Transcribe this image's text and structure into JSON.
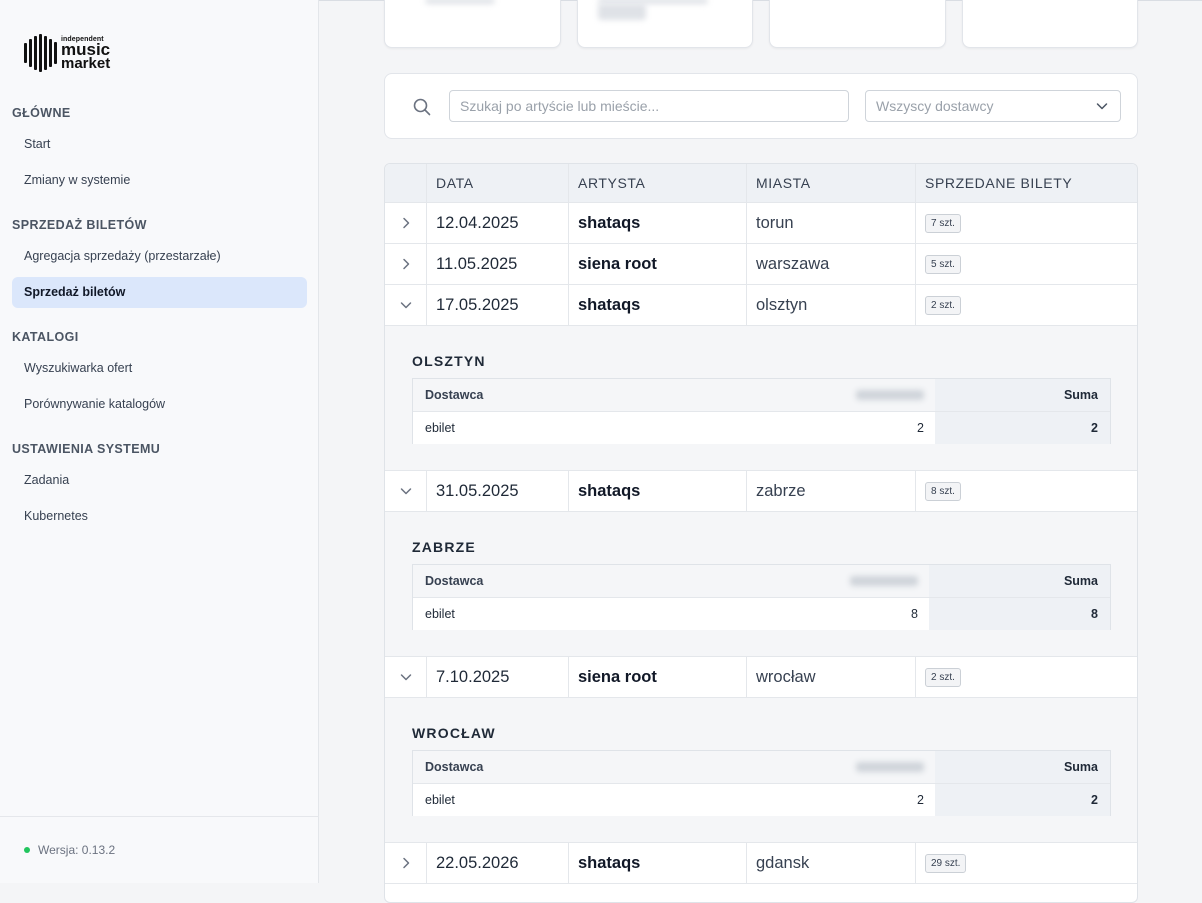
{
  "brand": {
    "line1": "independent",
    "line2": "music",
    "line3": "market"
  },
  "nav": {
    "sections": [
      {
        "label": "GŁÓWNE",
        "items": [
          {
            "label": "Start"
          },
          {
            "label": "Zmiany w systemie"
          }
        ]
      },
      {
        "label": "SPRZEDAŻ BILETÓW",
        "items": [
          {
            "label": "Agregacja sprzedaży (przestarzałe)"
          },
          {
            "label": "Sprzedaż biletów",
            "active": true
          }
        ]
      },
      {
        "label": "KATALOGI",
        "items": [
          {
            "label": "Wyszukiwarka ofert"
          },
          {
            "label": "Porównywanie katalogów"
          }
        ]
      },
      {
        "label": "USTAWIENIA SYSTEMU",
        "items": [
          {
            "label": "Zadania"
          },
          {
            "label": "Kubernetes"
          }
        ]
      }
    ]
  },
  "version": {
    "label": "Wersja: 0.13.2"
  },
  "filters": {
    "search_placeholder": "Szukaj po artyście lub mieście...",
    "supplier_value": "Wszyscy dostawcy"
  },
  "table": {
    "headers": {
      "date": "DATA",
      "artist": "ARTYSTA",
      "city": "MIASTA",
      "sold": "SPRZEDANE BILETY"
    },
    "rows": [
      {
        "date": "12.04.2025",
        "artist": "shataqs",
        "city": "torun",
        "sold": "7 szt.",
        "expanded": false
      },
      {
        "date": "11.05.2025",
        "artist": "siena root",
        "city": "warszawa",
        "sold": "5 szt.",
        "expanded": false
      },
      {
        "date": "17.05.2025",
        "artist": "shataqs",
        "city": "olsztyn",
        "sold": "2 szt.",
        "expanded": true,
        "detail": {
          "title": "OLSZTYN",
          "col_supplier": "Dostawca",
          "col_sum": "Suma",
          "supplier": "ebilet",
          "value": "2",
          "sum": "2"
        }
      },
      {
        "date": "31.05.2025",
        "artist": "shataqs",
        "city": "zabrze",
        "sold": "8 szt.",
        "expanded": true,
        "detail": {
          "title": "ZABRZE",
          "col_supplier": "Dostawca",
          "col_sum": "Suma",
          "supplier": "ebilet",
          "value": "8",
          "sum": "8"
        }
      },
      {
        "date": "7.10.2025",
        "artist": "siena root",
        "city": "wrocław",
        "sold": "2 szt.",
        "expanded": true,
        "detail": {
          "title": "WROCŁAW",
          "col_supplier": "Dostawca",
          "col_sum": "Suma",
          "supplier": "ebilet",
          "value": "2",
          "sum": "2"
        }
      },
      {
        "date": "22.05.2026",
        "artist": "shataqs",
        "city": "gdansk",
        "sold": "29 szt.",
        "expanded": false
      }
    ]
  },
  "colors": {
    "accent_active": "#dbe7fb",
    "status_dot": "#22c55e"
  }
}
